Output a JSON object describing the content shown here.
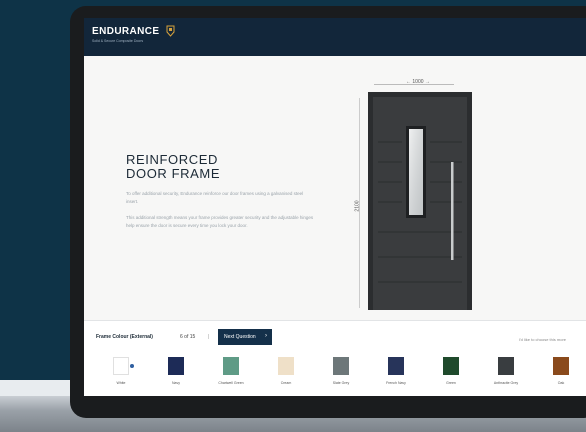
{
  "brand": {
    "name": "ENDURANCE",
    "tagline": "Solid & Secure Composite Doors"
  },
  "hero": {
    "heading_line1": "REINFORCED",
    "heading_line2": "DOOR FRAME",
    "paragraph1": "To offer additional security, Endurance reinforce our door frames using a galvanised steel insert.",
    "paragraph2": "This additional strength means your frame provides greater security and the adjustable hinges help ensure the door is secure every time you lock your door."
  },
  "dimensions": {
    "width": "← 1000 →",
    "height": "2100"
  },
  "configurator": {
    "frame_colour_label": "Frame Colour (External)",
    "step_count": "6 of 15",
    "separator": "|",
    "next_button": "Next Question",
    "next_arrow": "›",
    "right_link": "I'd like to choose this more",
    "swatches": [
      {
        "name": "White",
        "color": "#ffffff",
        "selected": true
      },
      {
        "name": "Navy",
        "color": "#1d2b57"
      },
      {
        "name": "Chartwell Green",
        "color": "#5f9b86"
      },
      {
        "name": "Cream",
        "color": "#efe0c8"
      },
      {
        "name": "Slate Grey",
        "color": "#6d7779"
      },
      {
        "name": "French Navy",
        "color": "#27345a"
      },
      {
        "name": "Green",
        "color": "#1f4a2c"
      },
      {
        "name": "Anthracite Grey",
        "color": "#393d40"
      },
      {
        "name": "Oak",
        "color": "#8a4a1c"
      }
    ]
  },
  "colors": {
    "background": "#0e3347",
    "header": "#12263a",
    "button": "#14304a",
    "door": "#3a3c3e"
  }
}
